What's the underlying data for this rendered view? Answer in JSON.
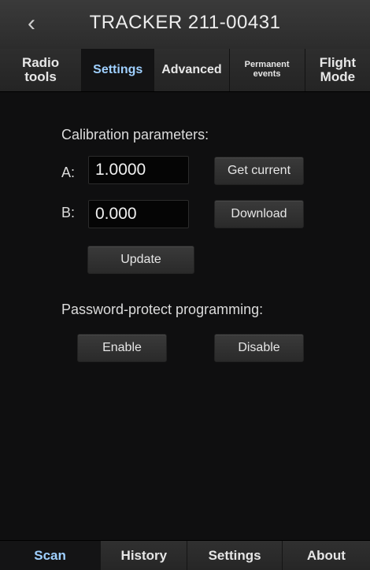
{
  "header": {
    "back_icon": "chevron-left-icon",
    "back_glyph": "‹",
    "title": "TRACKER  211-00431"
  },
  "tabs": [
    {
      "label": "Radio\ntools",
      "active": false
    },
    {
      "label": "Settings",
      "active": true
    },
    {
      "label": "Advanced",
      "active": false
    },
    {
      "label": "Permanent\nevents",
      "active": false
    },
    {
      "label": "Flight\nMode",
      "active": false
    }
  ],
  "calibration": {
    "heading": "Calibration parameters:",
    "a_label": "A:",
    "a_value": "1.0000",
    "b_label": "B:",
    "b_value": "0.000",
    "get_current_label": "Get current",
    "download_label": "Download",
    "update_label": "Update"
  },
  "password": {
    "heading": "Password-protect programming:",
    "enable_label": "Enable",
    "disable_label": "Disable"
  },
  "bottom_nav": [
    {
      "label": "Scan",
      "active": true
    },
    {
      "label": "History",
      "active": false
    },
    {
      "label": "Settings",
      "active": false
    },
    {
      "label": "About",
      "active": false
    }
  ],
  "colors": {
    "accent": "#9fd0ff",
    "background": "#0f0f10"
  }
}
